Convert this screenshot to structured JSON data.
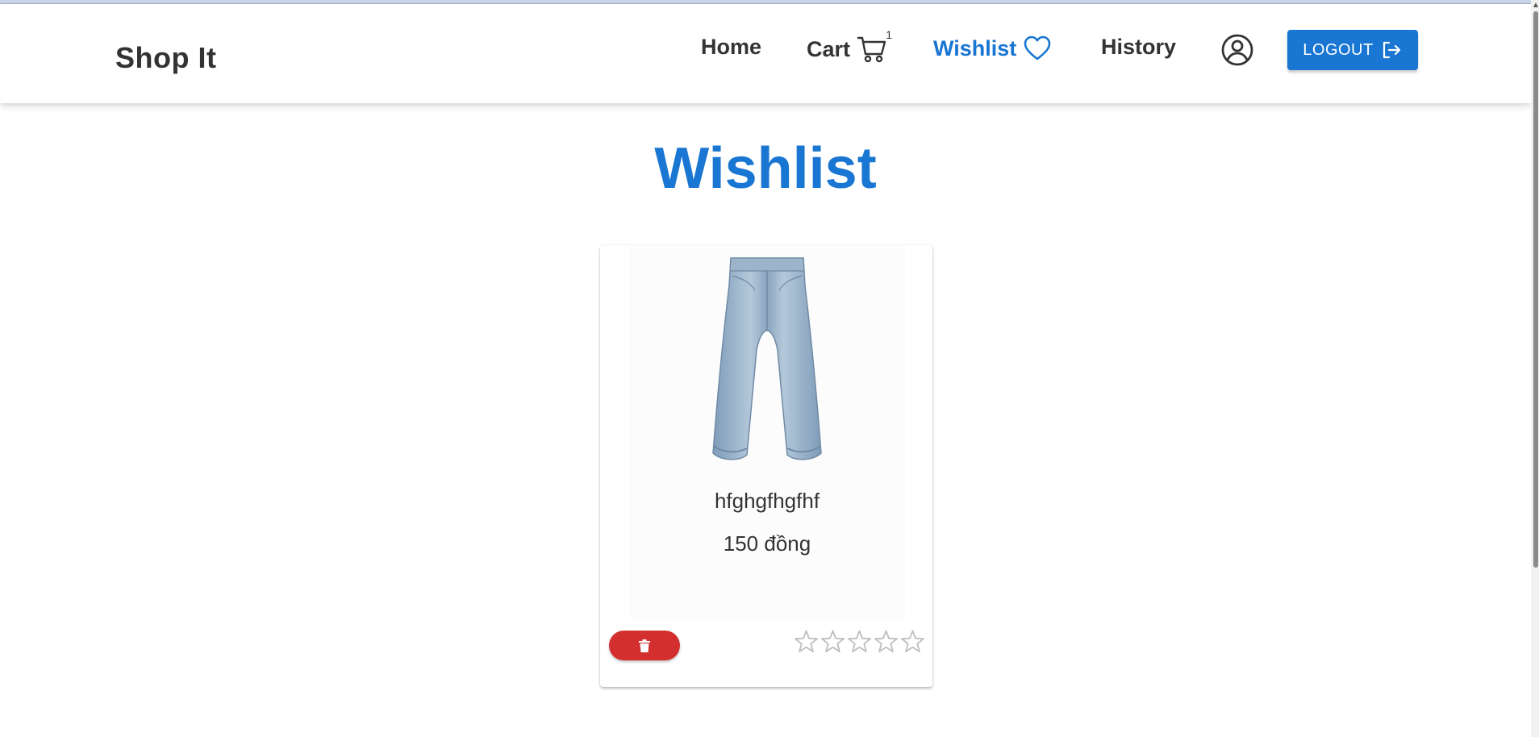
{
  "header": {
    "brand": "Shop It",
    "nav": {
      "home": "Home",
      "cart": "Cart",
      "cart_count": "1",
      "wishlist": "Wishlist",
      "history": "History"
    },
    "logout_label": "LOGOUT"
  },
  "colors": {
    "primary": "#1976d2",
    "danger": "#d32f2f",
    "text": "#333333",
    "star_empty": "#bdbdbd"
  },
  "icons": {
    "cart": "cart-icon",
    "wishlist": "heart-outline-icon",
    "account": "account-circle-icon",
    "logout": "logout-icon",
    "delete": "trash-icon",
    "rating": "star-outline-icon"
  },
  "main": {
    "title": "Wishlist",
    "items": [
      {
        "name": "hfghgfhgfhf",
        "price": "150 đồng",
        "rating": 0,
        "rating_max": 5
      }
    ]
  }
}
